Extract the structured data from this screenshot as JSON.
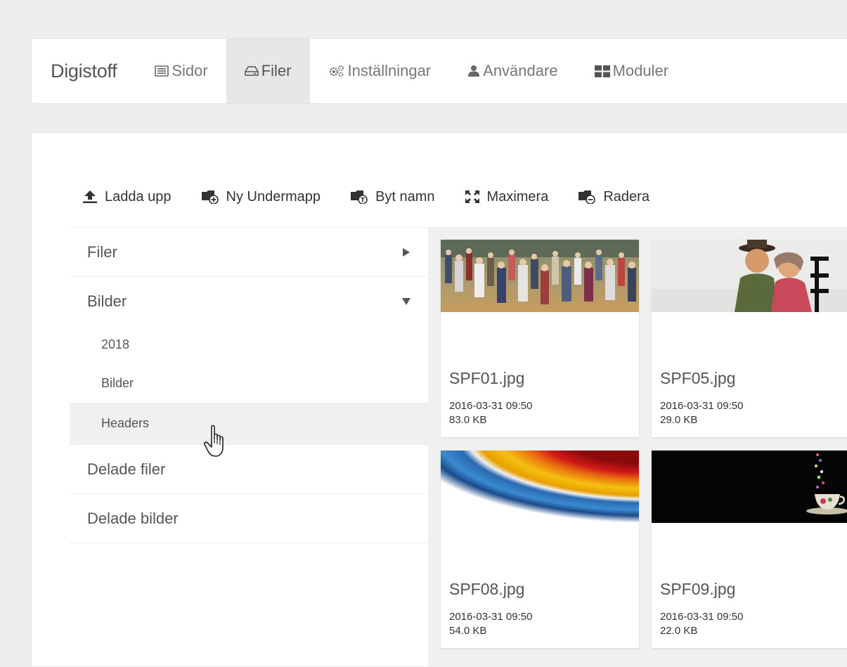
{
  "navbar": {
    "brand": "Digistoff",
    "items": [
      {
        "label": "Sidor",
        "icon": "list-icon"
      },
      {
        "label": "Filer",
        "icon": "hdd-icon",
        "active": true
      },
      {
        "label": "Inställningar",
        "icon": "cogs-icon"
      },
      {
        "label": "Användare",
        "icon": "user-icon"
      },
      {
        "label": "Moduler",
        "icon": "grid-icon"
      }
    ]
  },
  "toolbar": {
    "upload": "Ladda upp",
    "new_folder": "Ny Undermapp",
    "rename": "Byt namn",
    "maximize": "Maximera",
    "delete": "Radera"
  },
  "tree": {
    "items": [
      {
        "label": "Filer",
        "state": "collapsed"
      },
      {
        "label": "Bilder",
        "state": "expanded",
        "children": [
          "2018",
          "Bilder",
          "Headers"
        ]
      },
      {
        "label": "Delade filer"
      },
      {
        "label": "Delade bilder"
      }
    ]
  },
  "files": [
    {
      "name": "SPF01.jpg",
      "date": "2016-03-31 09:50",
      "size": "83.0 KB"
    },
    {
      "name": "SPF05.jpg",
      "date": "2016-03-31 09:50",
      "size": "29.0 KB"
    },
    {
      "name": "SPF08.jpg",
      "date": "2016-03-31 09:50",
      "size": "54.0 KB"
    },
    {
      "name": "SPF09.jpg",
      "date": "2016-03-31 09:50",
      "size": "22.0 KB"
    }
  ],
  "colors": {
    "background": "#eeeeee",
    "active_nav": "#e7e7e7",
    "hover_row": "#f0f0f0",
    "text": "#333333",
    "muted": "#777777"
  }
}
